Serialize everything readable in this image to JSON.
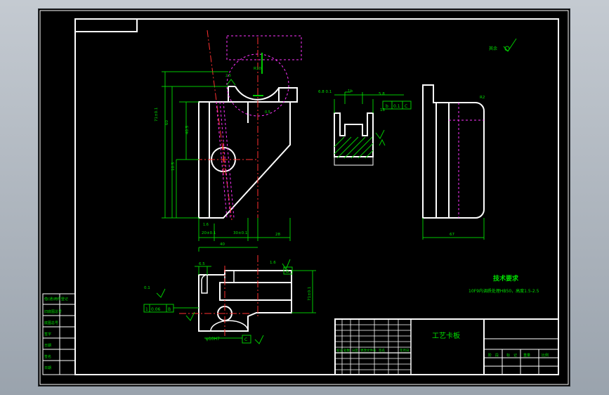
{
  "title_block": {
    "drawing_name": "工艺卡板"
  },
  "technical_requirements": {
    "heading": "技术要求",
    "text": "10F9内调质处理HB50，高度1.5-2.5"
  },
  "dimensions": {
    "main_view_height_total": "71±0.1",
    "main_view_height": "60",
    "main_view_inner": "40.5",
    "main_view_left": "10.5",
    "main_view_bottom_left": "20±0.1",
    "main_view_bottom_mid": "30±0.1",
    "main_view_bottom_right": "28",
    "main_view_total_width": "40",
    "main_view_corner": "1.6",
    "radius_r10": "R10",
    "arc_dim": "2.5",
    "arc_dim2": "0.5",
    "side_view_top": "5.8",
    "side_view_tol": "6.8 0.1",
    "side_view_mid": "1b",
    "side_view_right": "18",
    "right_view_width": "67",
    "right_view_r": "R2",
    "bottom_view_b": "6.5",
    "bottom_view_tol": "0.1",
    "bottom_view_perp": "0.06",
    "bottom_view_hole": "φ10H7",
    "bottom_view_right": "71±0.1",
    "bottom_view_16": "1.6",
    "roughness_other": "其余"
  },
  "tolerance_frames": {
    "side_view": [
      "b",
      "0.1",
      "C"
    ],
    "bottom_view": [
      "1",
      "0.06",
      "B"
    ],
    "bottom_datum_c": "C",
    "right_datum_b": "B"
  },
  "left_table": {
    "rows": [
      "借(通)用件登记",
      "旧底图总号",
      "底图总号",
      "签字",
      "日期",
      "签名",
      "日期"
    ]
  },
  "title_table": {
    "rows": [
      "标记",
      "处数",
      "分区",
      "更改文件号",
      "签名",
      "年月日"
    ]
  },
  "right_table": {
    "cells": [
      "阶",
      "段",
      "标",
      "记",
      "重量",
      "比例"
    ]
  }
}
